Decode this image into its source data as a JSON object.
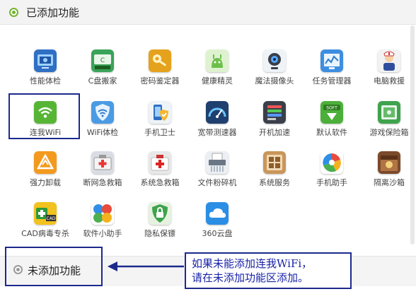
{
  "sections": {
    "added_title": "已添加功能",
    "not_added_title": "未添加功能"
  },
  "note": {
    "line1": "如果未能添加连我WiFi，",
    "line2": "请在未添加功能区添加。"
  },
  "apps": [
    {
      "label": "性能体检",
      "icon": "performance-check-icon"
    },
    {
      "label": "C盘搬家",
      "icon": "c-drive-move-icon"
    },
    {
      "label": "密码鉴定器",
      "icon": "password-check-icon"
    },
    {
      "label": "健康精灵",
      "icon": "health-sprite-icon"
    },
    {
      "label": "魔法摄像头",
      "icon": "magic-camera-icon"
    },
    {
      "label": "任务管理器",
      "icon": "task-manager-icon"
    },
    {
      "label": "电脑救援",
      "icon": "pc-rescue-icon"
    },
    {
      "label": "连我WiFi",
      "icon": "wifi-connect-icon"
    },
    {
      "label": "WiFi体检",
      "icon": "wifi-check-icon"
    },
    {
      "label": "手机卫士",
      "icon": "phone-guard-icon"
    },
    {
      "label": "宽带测速器",
      "icon": "speed-test-icon"
    },
    {
      "label": "开机加速",
      "icon": "boot-speedup-icon"
    },
    {
      "label": "默认软件",
      "icon": "default-software-icon"
    },
    {
      "label": "游戏保险箱",
      "icon": "game-safe-icon"
    },
    {
      "label": "强力卸载",
      "icon": "force-uninstall-icon"
    },
    {
      "label": "断网急救箱",
      "icon": "network-firstaid-icon"
    },
    {
      "label": "系统急救箱",
      "icon": "system-firstaid-icon"
    },
    {
      "label": "文件粉碎机",
      "icon": "file-shredder-icon"
    },
    {
      "label": "系统服务",
      "icon": "system-service-icon"
    },
    {
      "label": "手机助手",
      "icon": "phone-assistant-icon"
    },
    {
      "label": "隔离沙箱",
      "icon": "sandbox-icon"
    },
    {
      "label": "CAD病毒专杀",
      "icon": "cad-virus-icon"
    },
    {
      "label": "软件小助手",
      "icon": "software-helper-icon"
    },
    {
      "label": "隐私保镖",
      "icon": "privacy-guard-icon"
    },
    {
      "label": "360云盘",
      "icon": "cloud-disk-icon"
    }
  ]
}
